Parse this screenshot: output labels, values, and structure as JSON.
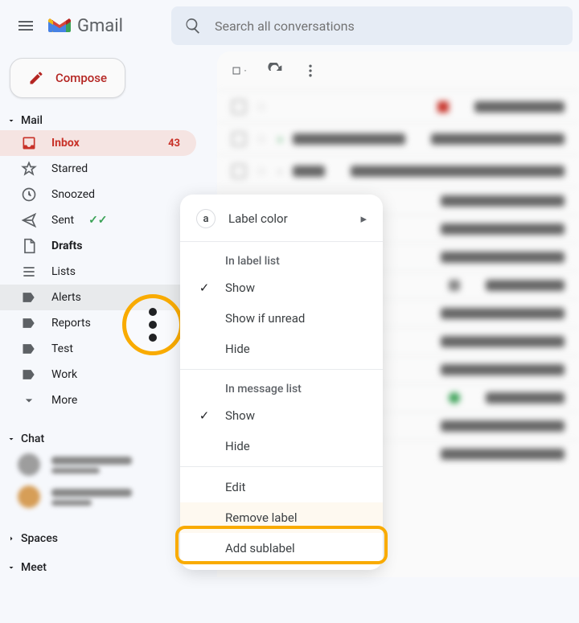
{
  "header": {
    "app_name": "Gmail",
    "search_placeholder": "Search all conversations"
  },
  "compose": {
    "label": "Compose"
  },
  "sidebar": {
    "sections": {
      "mail": "Mail",
      "chat": "Chat",
      "spaces": "Spaces",
      "meet": "Meet"
    },
    "items": [
      {
        "label": "Inbox",
        "count": "43"
      },
      {
        "label": "Starred"
      },
      {
        "label": "Snoozed"
      },
      {
        "label": "Sent"
      },
      {
        "label": "Drafts"
      },
      {
        "label": "Lists"
      },
      {
        "label": "Alerts"
      },
      {
        "label": "Reports"
      },
      {
        "label": "Test"
      },
      {
        "label": "Work"
      },
      {
        "label": "More"
      }
    ]
  },
  "context_menu": {
    "label_color": "Label color",
    "section_label_list": "In label list",
    "show": "Show",
    "show_if_unread": "Show if unread",
    "hide": "Hide",
    "section_message_list": "In message list",
    "edit": "Edit",
    "remove_label": "Remove label",
    "add_sublabel": "Add sublabel"
  },
  "colors": {
    "accent_red": "#d93025",
    "highlight_amber": "#f9ab00"
  }
}
